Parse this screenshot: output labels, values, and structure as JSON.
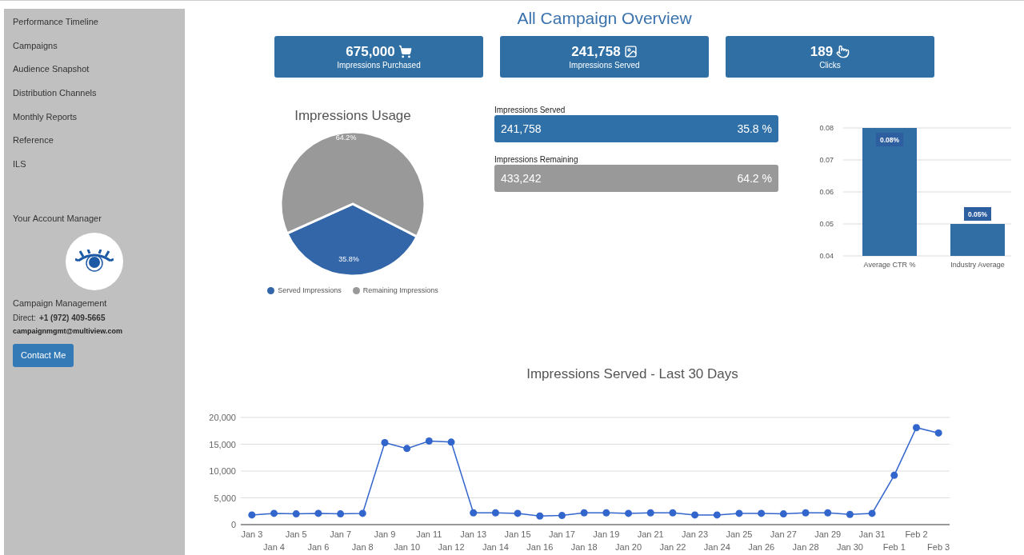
{
  "sidebar": {
    "items": [
      {
        "label": "Performance Timeline"
      },
      {
        "label": "Campaigns"
      },
      {
        "label": "Audience Snapshot"
      },
      {
        "label": "Distribution Channels"
      },
      {
        "label": "Monthly Reports"
      },
      {
        "label": "Reference"
      },
      {
        "label": "ILS"
      }
    ],
    "account_manager": {
      "heading": "Your Account Manager",
      "name": "Campaign Management",
      "direct_label": "Direct:",
      "phone": "+1 (972) 409-5665",
      "email": "campaignmgmt@multiview.com",
      "button": "Contact Me"
    }
  },
  "title": "All Campaign Overview",
  "stats": [
    {
      "value": "675,000",
      "label": "Impressions Purchased",
      "kind": "cart"
    },
    {
      "value": "241,758",
      "label": "Impressions Served",
      "kind": "image"
    },
    {
      "value": "189",
      "label": "Clicks",
      "kind": "pointer"
    }
  ],
  "usage": {
    "title": "Impressions Usage",
    "chart_data": {
      "type": "pie",
      "categories": [
        "Served Impressions",
        "Remaining Impressions"
      ],
      "values": [
        35.8,
        64.2
      ],
      "colors": [
        "#3366a8",
        "#999999"
      ],
      "value_labels": [
        "35.8%",
        "64.2%"
      ]
    }
  },
  "bars": [
    {
      "label": "Impressions Served",
      "value": "241,758",
      "percent": "35.8 %",
      "color": "#3070a8"
    },
    {
      "label": "Impressions Remaining",
      "value": "433,242",
      "percent": "64.2 %",
      "color": "#999999"
    }
  ],
  "ctr": {
    "chart_data": {
      "type": "bar",
      "categories": [
        "Average CTR %",
        "Industry Average"
      ],
      "values": [
        0.08,
        0.05
      ],
      "grid": true,
      "ylim": [
        0.04,
        0.08
      ],
      "yticks": [
        {
          "value": 0.04,
          "label": "0.04"
        },
        {
          "value": 0.05,
          "label": "0.05"
        },
        {
          "value": 0.06,
          "label": "0.06"
        },
        {
          "value": 0.07,
          "label": "0.07"
        },
        {
          "value": 0.08,
          "label": "0.08"
        }
      ],
      "value_labels": [
        "0.08%",
        "0.05%"
      ]
    }
  },
  "daily": {
    "title": "Impressions Served - Last 30 Days",
    "chart_data": {
      "type": "line",
      "categories": [
        "Jan 3",
        "Jan 4",
        "Jan 5",
        "Jan 6",
        "Jan 7",
        "Jan 8",
        "Jan 9",
        "Jan 10",
        "Jan 11",
        "Jan 12",
        "Jan 13",
        "Jan 14",
        "Jan 15",
        "Jan 16",
        "Jan 17",
        "Jan 18",
        "Jan 19",
        "Jan 20",
        "Jan 21",
        "Jan 22",
        "Jan 23",
        "Jan 24",
        "Jan 25",
        "Jan 26",
        "Jan 27",
        "Jan 28",
        "Jan 29",
        "Jan 30",
        "Jan 31",
        "Feb 1",
        "Feb 2",
        "Feb 3"
      ],
      "series": [
        {
          "color": "#3366cc",
          "marker": true,
          "values": [
            1800,
            2100,
            2000,
            2100,
            2000,
            2100,
            15300,
            14200,
            15600,
            15400,
            2200,
            2200,
            2100,
            1600,
            1700,
            2200,
            2200,
            2100,
            2200,
            2200,
            1800,
            1800,
            2100,
            2100,
            2000,
            2200,
            2200,
            1900,
            2100,
            9200,
            18100,
            17100
          ]
        }
      ],
      "grid": true,
      "ylim": [
        0,
        20000
      ],
      "yticks": [
        {
          "value": 0,
          "label": "0"
        },
        {
          "value": 5000,
          "label": "5,000"
        },
        {
          "value": 10000,
          "label": "10,000"
        },
        {
          "value": 15000,
          "label": "15,000"
        },
        {
          "value": 20000,
          "label": "20,000"
        }
      ]
    }
  }
}
